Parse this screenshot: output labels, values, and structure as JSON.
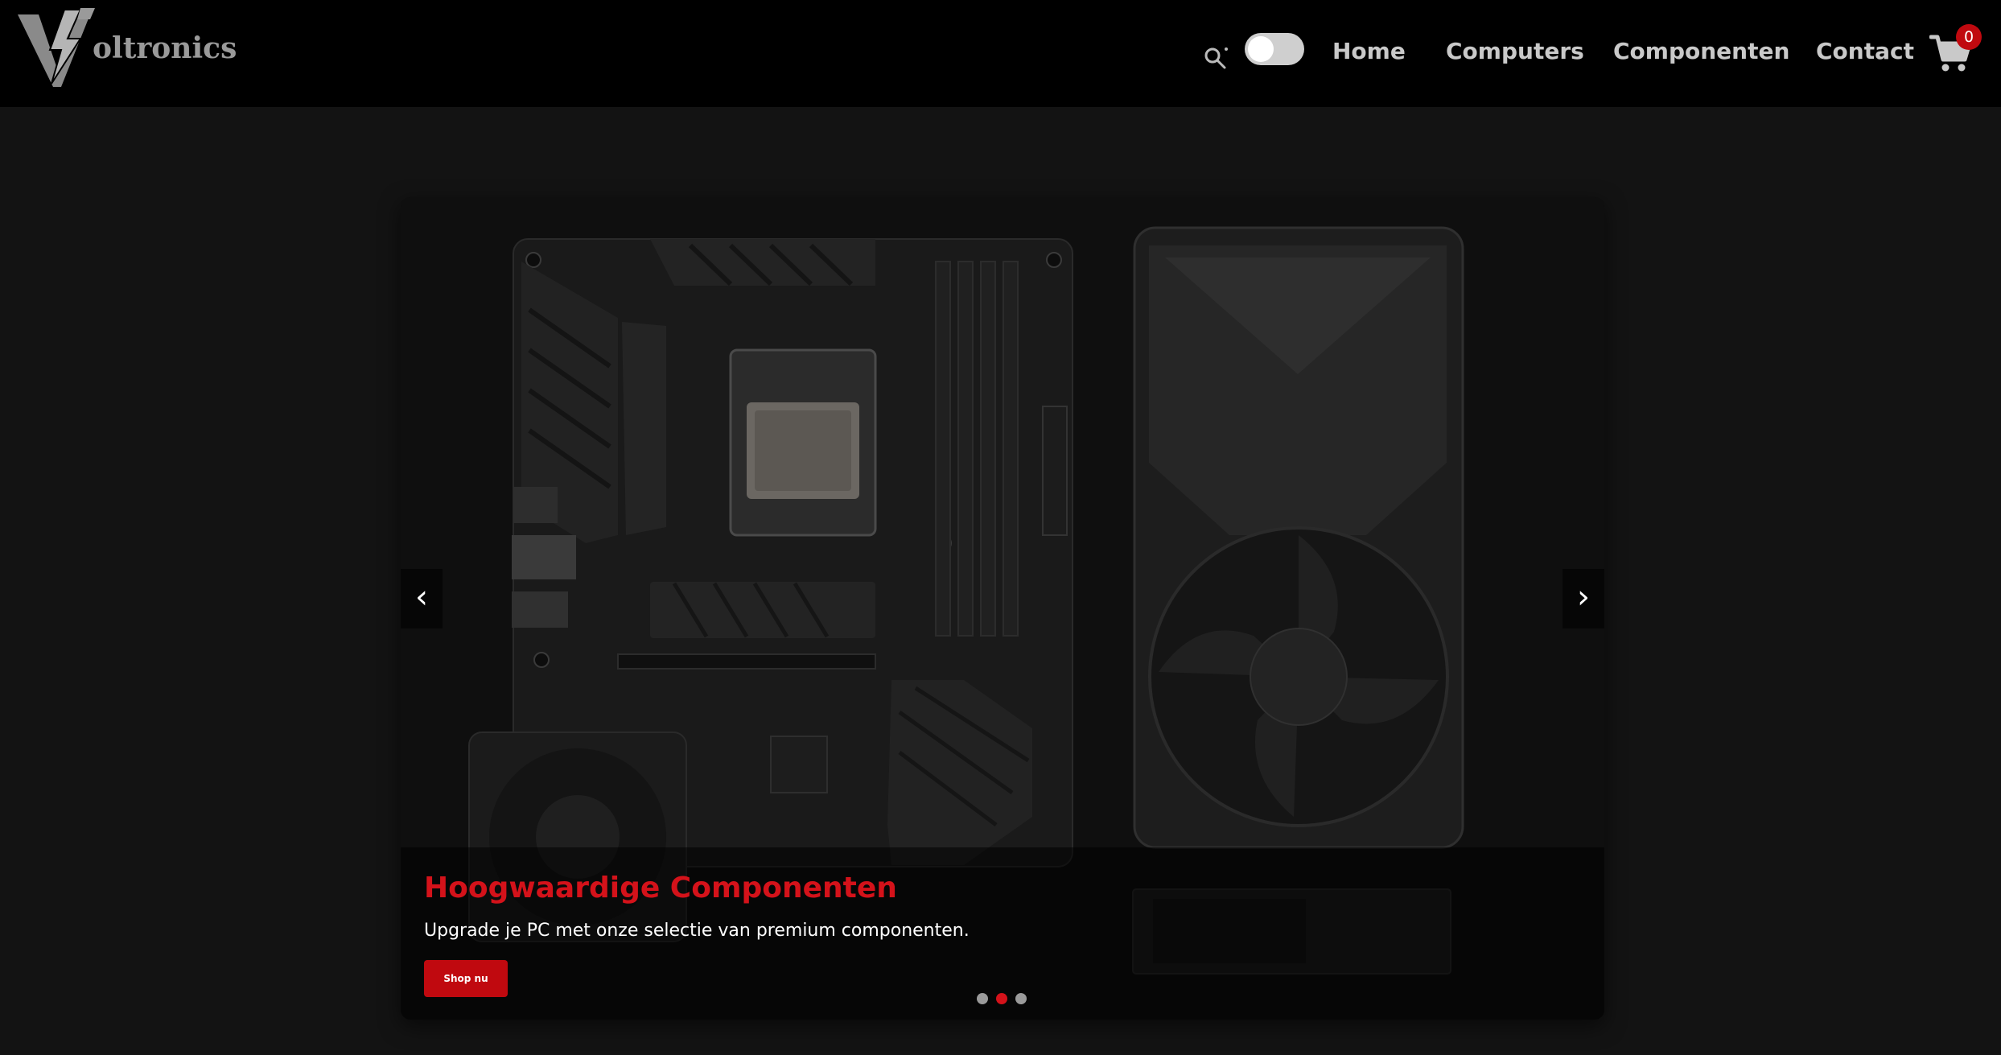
{
  "header": {
    "brand": "Voltronics",
    "nav": [
      {
        "label": "Home"
      },
      {
        "label": "Computers"
      },
      {
        "label": "Componenten"
      },
      {
        "label": "Contact"
      }
    ],
    "cart": {
      "count": "0",
      "icon": "shopping-cart-icon"
    },
    "search": {
      "icon": "search-icon"
    },
    "theme_toggle": {
      "state": "off"
    }
  },
  "carousel": {
    "prev_label": "‹",
    "next_label": "›",
    "slide": {
      "title": "Hoogwaardige Componenten",
      "text": "Upgrade je PC met onze selectie van premium componenten.",
      "button_label": "Shop nu",
      "image": "motherboard-and-graphics-card"
    },
    "slide_count": 3,
    "active_index": 1
  },
  "colors": {
    "accent": "#c0090f",
    "title_red": "#d4121a",
    "header_bg": "#000000",
    "page_bg": "#131313",
    "nav_text": "#c9c9c9"
  }
}
